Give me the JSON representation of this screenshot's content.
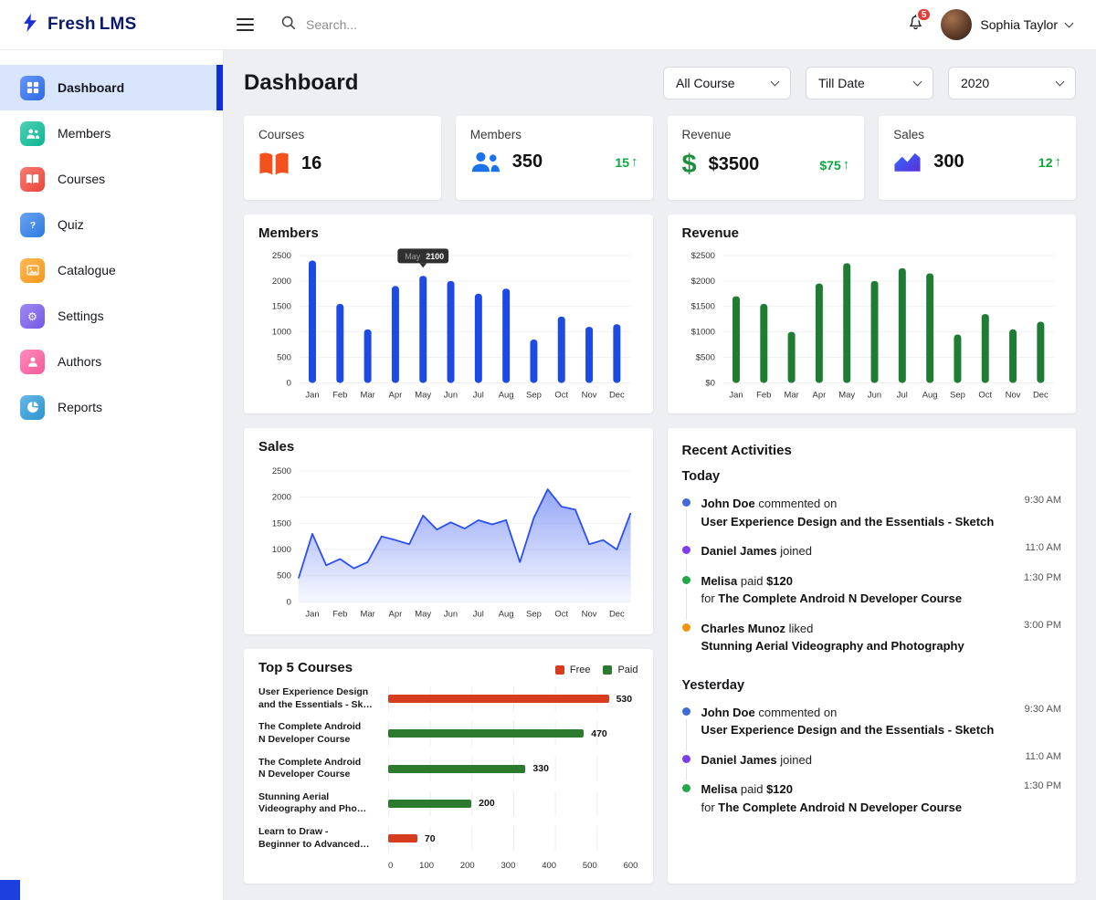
{
  "topbar": {
    "logo": {
      "part1": "Fresh",
      "part2": "LMS"
    },
    "search_placeholder": "Search...",
    "notification_count": "5",
    "user_name": "Sophia Taylor"
  },
  "sidebar": {
    "items": [
      {
        "label": "Dashboard",
        "icon": "dashboard-icon",
        "color": "#2d6ff2",
        "active": true
      },
      {
        "label": "Members",
        "icon": "members-icon",
        "color": "#0bbf9a",
        "active": false
      },
      {
        "label": "Courses",
        "icon": "courses-icon",
        "color": "#f5493d",
        "active": false
      },
      {
        "label": "Quiz",
        "icon": "quiz-icon",
        "color": "#2f80ed",
        "active": false
      },
      {
        "label": "Catalogue",
        "icon": "catalogue-icon",
        "color": "#ff9f1a",
        "active": false
      },
      {
        "label": "Settings",
        "icon": "settings-icon",
        "color": "#7a5cf0",
        "active": false
      },
      {
        "label": "Authors",
        "icon": "authors-icon",
        "color": "#ff5fa2",
        "active": false
      },
      {
        "label": "Reports",
        "icon": "reports-icon",
        "color": "#2d9cdb",
        "active": false
      }
    ]
  },
  "header": {
    "title": "Dashboard",
    "filters": [
      "All Course",
      "Till Date",
      "2020"
    ]
  },
  "stats": [
    {
      "label": "Courses",
      "value": "16",
      "delta": "",
      "icon": "book-icon",
      "color": "#f4511e"
    },
    {
      "label": "Members",
      "value": "350",
      "delta": "15",
      "icon": "people-icon",
      "color": "#1a73e8"
    },
    {
      "label": "Revenue",
      "value": "$3500",
      "delta": "$75",
      "icon": "dollar-icon",
      "color": "#1e8e3e"
    },
    {
      "label": "Sales",
      "value": "300",
      "delta": "12",
      "icon": "area-chart-icon",
      "color": "#4b3fe4"
    }
  ],
  "chart_data": [
    {
      "id": "members",
      "type": "bar",
      "title": "Members",
      "categories": [
        "Jan",
        "Feb",
        "Mar",
        "Apr",
        "May",
        "Jun",
        "Jul",
        "Aug",
        "Sep",
        "Oct",
        "Nov",
        "Dec"
      ],
      "values": [
        2400,
        1550,
        1050,
        1900,
        2100,
        2000,
        1750,
        1850,
        850,
        1300,
        1100,
        1150
      ],
      "ylim": [
        0,
        2500
      ],
      "yticks": [
        0,
        500,
        1000,
        1500,
        2000,
        2500
      ],
      "y_prefix": "",
      "bar_color": "#1d49e5",
      "grid": true,
      "legend_position": "none",
      "tooltip": {
        "index": 4,
        "label": "May",
        "value": "2100"
      }
    },
    {
      "id": "revenue",
      "type": "bar",
      "title": "Revenue",
      "categories": [
        "Jan",
        "Feb",
        "Mar",
        "Apr",
        "May",
        "Jun",
        "Jul",
        "Aug",
        "Sep",
        "Oct",
        "Nov",
        "Dec"
      ],
      "values": [
        1700,
        1550,
        1000,
        1950,
        2350,
        2000,
        2250,
        2150,
        950,
        1350,
        1050,
        1200
      ],
      "ylim": [
        0,
        2500
      ],
      "yticks": [
        0,
        500,
        1000,
        1500,
        2000,
        2500
      ],
      "y_prefix": "$",
      "bar_color": "#1e7d32",
      "grid": true,
      "legend_position": "none"
    },
    {
      "id": "sales",
      "type": "line",
      "title": "Sales",
      "x_labels": [
        "Jan",
        "Feb",
        "Mar",
        "Apr",
        "May",
        "Jun",
        "Jul",
        "Aug",
        "Sep",
        "Oct",
        "Nov",
        "Dec"
      ],
      "values": [
        450,
        1300,
        700,
        820,
        640,
        760,
        1250,
        1180,
        1100,
        1650,
        1380,
        1520,
        1400,
        1560,
        1480,
        1560,
        760,
        1600,
        2150,
        1820,
        1760,
        1100,
        1180,
        1000,
        1700
      ],
      "ylim": [
        0,
        2500
      ],
      "yticks": [
        0,
        500,
        1000,
        1500,
        2000,
        2500
      ],
      "y_prefix": "",
      "line_color": "#2b4ff0",
      "fill": "gradient",
      "grid": true,
      "legend_position": "none"
    },
    {
      "id": "top-courses",
      "type": "hbar",
      "title": "Top 5 Courses",
      "legend": [
        {
          "label": "Free",
          "color": "#d63c1e"
        },
        {
          "label": "Paid",
          "color": "#2c7a2e"
        }
      ],
      "items": [
        {
          "label": [
            "User Experience Design",
            "and the Essentials - Sk…"
          ],
          "value": 530,
          "series": "Free"
        },
        {
          "label": [
            "The Complete Android",
            "N Developer Course"
          ],
          "value": 470,
          "series": "Paid"
        },
        {
          "label": [
            "The Complete Android",
            "N Developer Course"
          ],
          "value": 330,
          "series": "Paid"
        },
        {
          "label": [
            "Stunning Aerial",
            "Videography and Pho…"
          ],
          "value": 200,
          "series": "Paid"
        },
        {
          "label": [
            "Learn to Draw -",
            "Beginner to Advanced…"
          ],
          "value": 70,
          "series": "Free"
        }
      ],
      "xlim": [
        0,
        600
      ],
      "xticks": [
        0,
        100,
        200,
        300,
        400,
        500,
        600
      ],
      "legend_position": "top-right"
    }
  ],
  "activities": {
    "title": "Recent Activities",
    "sections": [
      {
        "label": "Today",
        "items": [
          {
            "color": "#3f6ad8",
            "time": "9:30 AM",
            "line1": [
              [
                "John Doe",
                true
              ],
              [
                " commented on",
                false
              ]
            ],
            "line2": [
              [
                "User Experience Design and the Essentials - Sketch",
                true
              ]
            ]
          },
          {
            "color": "#7d3cf0",
            "time": "11:0 AM",
            "line1": [
              [
                "Daniel James",
                true
              ],
              [
                " joined",
                false
              ]
            ],
            "line2": null
          },
          {
            "color": "#22a84a",
            "time": "1:30 PM",
            "line1": [
              [
                "Melisa",
                true
              ],
              [
                " paid ",
                false
              ],
              [
                "$120",
                true
              ]
            ],
            "line2": [
              [
                "for ",
                false
              ],
              [
                "The Complete Android N Developer Course",
                true
              ]
            ]
          },
          {
            "color": "#f5930f",
            "time": "3:00 PM",
            "line1": [
              [
                "Charles Munoz",
                true
              ],
              [
                " liked",
                false
              ]
            ],
            "line2": [
              [
                "Stunning Aerial Videography and Photography",
                true
              ]
            ]
          }
        ]
      },
      {
        "label": "Yesterday",
        "items": [
          {
            "color": "#3f6ad8",
            "time": "9:30 AM",
            "line1": [
              [
                "John Doe",
                true
              ],
              [
                " commented on",
                false
              ]
            ],
            "line2": [
              [
                "User Experience Design and the Essentials - Sketch",
                true
              ]
            ]
          },
          {
            "color": "#7d3cf0",
            "time": "11:0 AM",
            "line1": [
              [
                "Daniel James",
                true
              ],
              [
                " joined",
                false
              ]
            ],
            "line2": null
          },
          {
            "color": "#22a84a",
            "time": "1:30 PM",
            "line1": [
              [
                "Melisa",
                true
              ],
              [
                " paid ",
                false
              ],
              [
                "$120",
                true
              ]
            ],
            "line2": [
              [
                "for ",
                false
              ],
              [
                "The Complete Android N Developer Course",
                true
              ]
            ]
          }
        ]
      }
    ]
  }
}
